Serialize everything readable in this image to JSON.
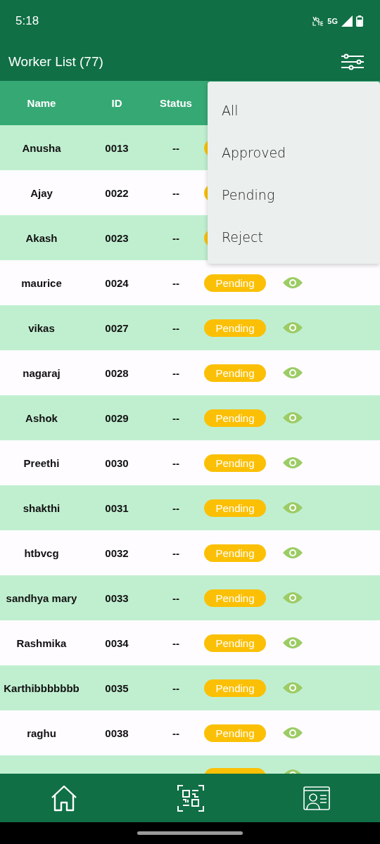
{
  "status_bar": {
    "time": "5:18",
    "network": "5G"
  },
  "header": {
    "title": "Worker List (77)"
  },
  "table": {
    "columns": [
      "Name",
      "ID",
      "Status"
    ],
    "rows": [
      {
        "name": "Anusha",
        "id": "0013",
        "status": "--"
      },
      {
        "name": "Ajay",
        "id": "0022",
        "status": "--"
      },
      {
        "name": "Akash",
        "id": "0023",
        "status": "--"
      },
      {
        "name": "maurice",
        "id": "0024",
        "status": "--",
        "badge": "Pending"
      },
      {
        "name": "vikas",
        "id": "0027",
        "status": "--",
        "badge": "Pending"
      },
      {
        "name": "nagaraj",
        "id": "0028",
        "status": "--",
        "badge": "Pending"
      },
      {
        "name": "Ashok",
        "id": "0029",
        "status": "--",
        "badge": "Pending"
      },
      {
        "name": "Preethi",
        "id": "0030",
        "status": "--",
        "badge": "Pending"
      },
      {
        "name": "shakthi",
        "id": "0031",
        "status": "--",
        "badge": "Pending"
      },
      {
        "name": "htbvcg",
        "id": "0032",
        "status": "--",
        "badge": "Pending"
      },
      {
        "name": "sandhya mary",
        "id": "0033",
        "status": "--",
        "badge": "Pending"
      },
      {
        "name": "Rashmika",
        "id": "0034",
        "status": "--",
        "badge": "Pending"
      },
      {
        "name": "Karthibbbbbbb",
        "id": "0035",
        "status": "--",
        "badge": "Pending"
      },
      {
        "name": "raghu",
        "id": "0038",
        "status": "--",
        "badge": "Pending"
      },
      {
        "kind": "partial"
      }
    ]
  },
  "filter_menu": {
    "items": [
      "All",
      "Approved",
      "Pending",
      "Reject"
    ]
  }
}
